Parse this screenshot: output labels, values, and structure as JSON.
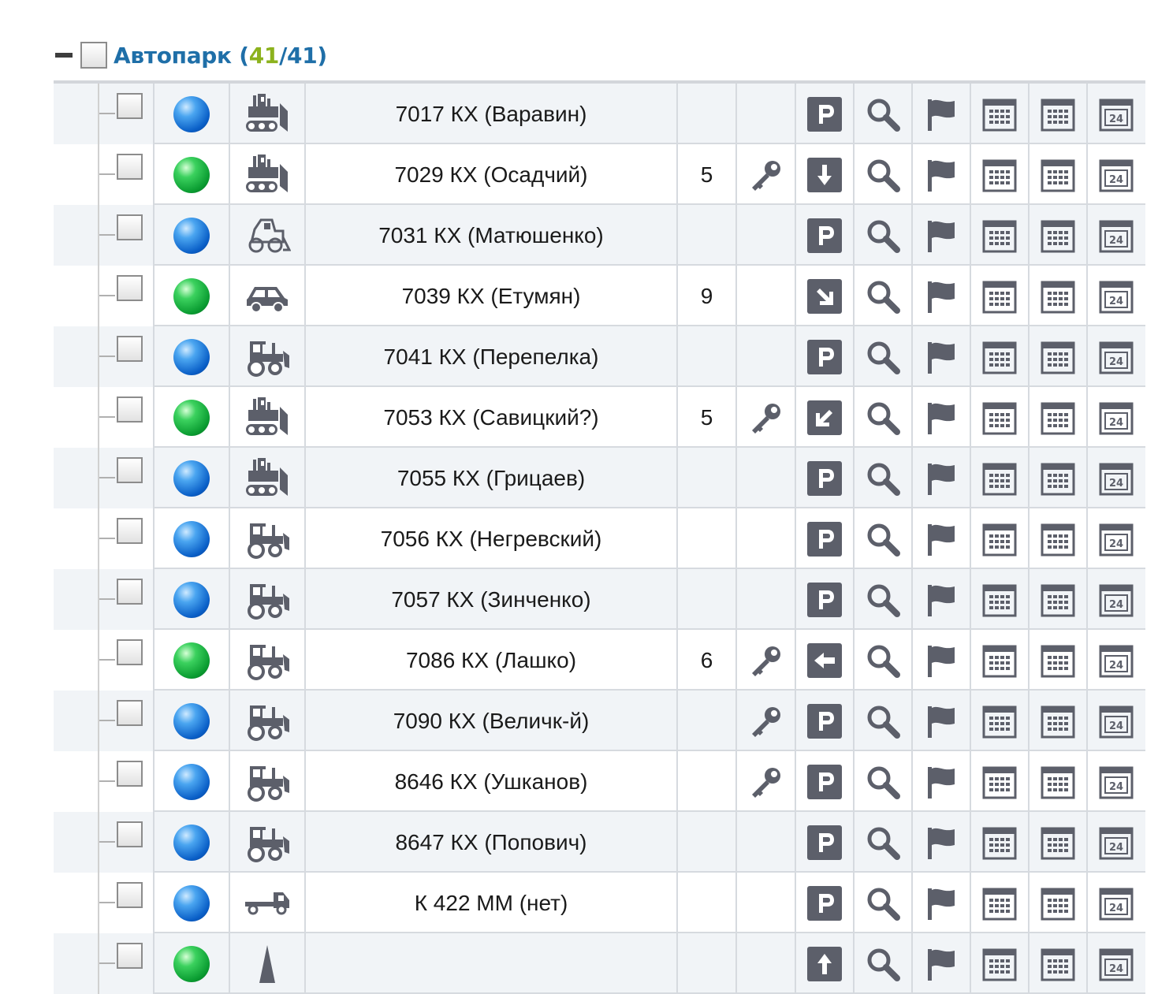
{
  "group": {
    "title": "Автопарк",
    "open_paren": "(",
    "online_count": "41",
    "separator": "/",
    "total_count": "41",
    "close_paren": ")"
  },
  "colors": {
    "title": "#1f6fa8",
    "online_count": "#8cb21d",
    "status_online": "#0a9c31",
    "status_offline": "#0a5fc7",
    "icon": "#5c5f6a"
  },
  "vehicles": [
    {
      "name": "7017 КХ (Варавин)",
      "status": "blue",
      "type": "bulldozer-icon",
      "count": "",
      "key": false,
      "action": "parking-icon"
    },
    {
      "name": "7029 КХ (Осадчий)",
      "status": "green",
      "type": "bulldozer-icon",
      "count": "5",
      "key": true,
      "action": "arrow-down-icon"
    },
    {
      "name": "7031 КХ (Матюшенко)",
      "status": "blue",
      "type": "loader-icon",
      "count": "",
      "key": false,
      "action": "parking-icon"
    },
    {
      "name": "7039 КХ (Етумян)",
      "status": "green",
      "type": "car-icon",
      "count": "9",
      "key": false,
      "action": "arrow-down-right-icon"
    },
    {
      "name": "7041 КХ (Перепелка)",
      "status": "blue",
      "type": "tractor-icon",
      "count": "",
      "key": false,
      "action": "parking-icon"
    },
    {
      "name": "7053 КХ (Савицкий?)",
      "status": "green",
      "type": "bulldozer-icon",
      "count": "5",
      "key": true,
      "action": "arrow-down-left-icon"
    },
    {
      "name": "7055 КХ (Грицаев)",
      "status": "blue",
      "type": "bulldozer-icon",
      "count": "",
      "key": false,
      "action": "parking-icon"
    },
    {
      "name": "7056 КХ (Негревский)",
      "status": "blue",
      "type": "tractor-icon",
      "count": "",
      "key": false,
      "action": "parking-icon"
    },
    {
      "name": "7057 КХ (Зинченко)",
      "status": "blue",
      "type": "tractor-icon",
      "count": "",
      "key": false,
      "action": "parking-icon"
    },
    {
      "name": "7086 КХ (Лашко)",
      "status": "green",
      "type": "tractor-icon",
      "count": "6",
      "key": true,
      "action": "arrow-left-icon"
    },
    {
      "name": "7090 КХ (Величк-й)",
      "status": "blue",
      "type": "tractor-icon",
      "count": "",
      "key": true,
      "action": "parking-icon"
    },
    {
      "name": "8646 КХ (Ушканов)",
      "status": "blue",
      "type": "tractor-icon",
      "count": "",
      "key": true,
      "action": "parking-icon"
    },
    {
      "name": "8647 КХ (Попович)",
      "status": "blue",
      "type": "tractor-icon",
      "count": "",
      "key": false,
      "action": "parking-icon"
    },
    {
      "name": "К 422 ММ (нет)",
      "status": "blue",
      "type": "truck-icon",
      "count": "",
      "key": false,
      "action": "parking-icon"
    },
    {
      "name": "",
      "status": "green",
      "type": "crane-icon",
      "count": "",
      "key": false,
      "action": "arrow-up-icon"
    }
  ],
  "row_tools": [
    "search-icon",
    "flag-icon",
    "calendar-grid-icon",
    "calendar-grid-icon",
    "calendar-24-icon"
  ]
}
